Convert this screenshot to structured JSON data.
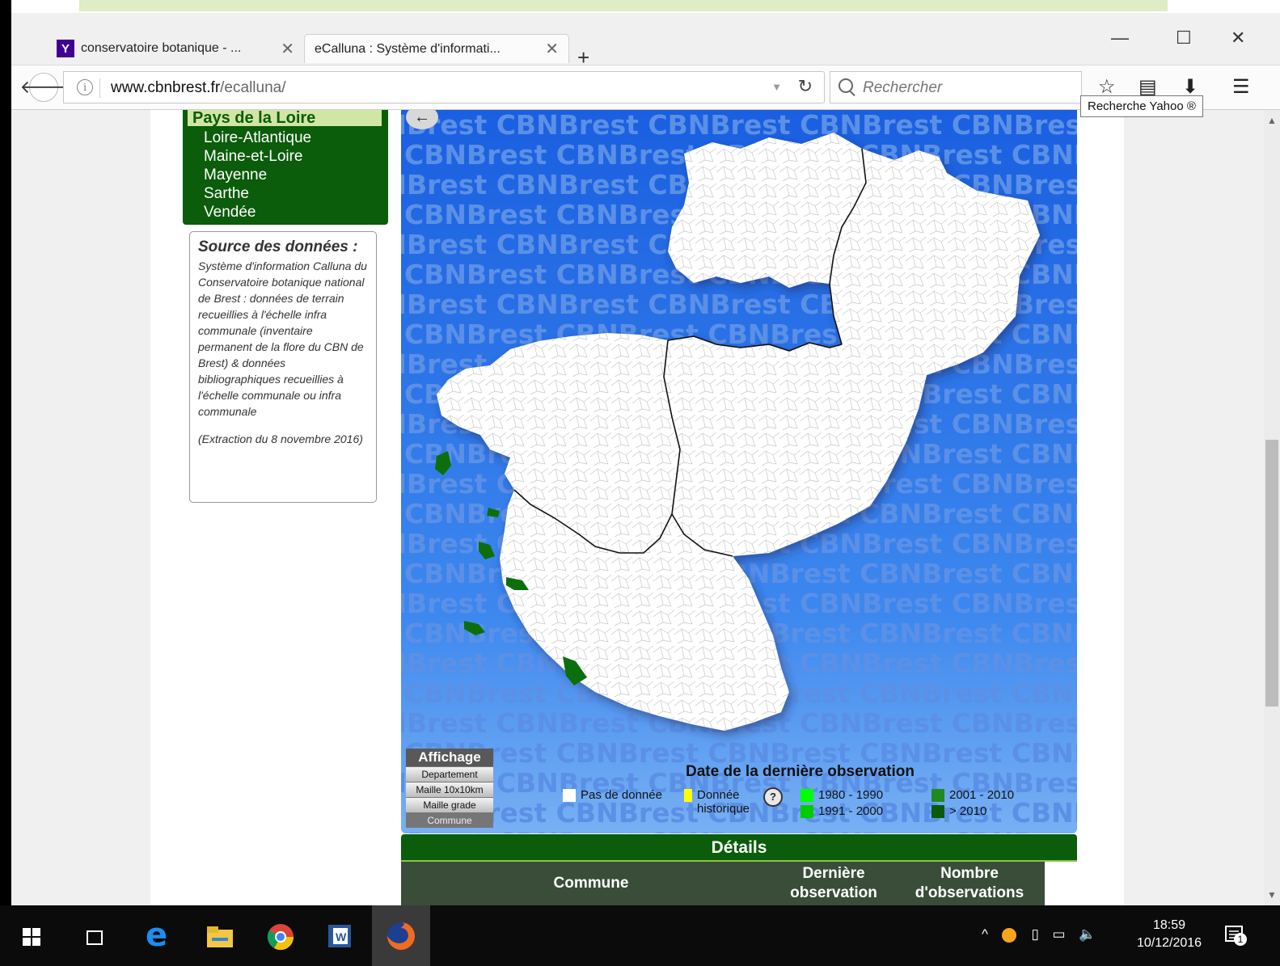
{
  "browser": {
    "tabs": [
      {
        "title": "conservatoire botanique - ...",
        "favicon": "Y",
        "active": false
      },
      {
        "title": "eCalluna : Système d'informati...",
        "active": true
      }
    ],
    "new_tab": "+",
    "window_controls": {
      "minimize": "—",
      "maximize": "☐",
      "close": "✕"
    },
    "url_host": "www.cbnbrest.fr",
    "url_path": "/ecalluna/",
    "search_placeholder": "Rechercher",
    "tooltip": "Recherche Yahoo ®",
    "toolbar_icons": [
      "star-icon",
      "reading-list-icon",
      "download-icon",
      "menu-icon"
    ]
  },
  "sidebar": {
    "region": "Pays de la Loire",
    "departments": [
      "Loire-Atlantique",
      "Maine-et-Loire",
      "Mayenne",
      "Sarthe",
      "Vendée"
    ],
    "source_title": "Source des données :",
    "source_body": "Système d'information Calluna du Conservatoire botanique national de Brest : données de terrain recueillies à l'échelle infra communale (inventaire permanent de la flore du CBN de Brest) & données bibliographiques recueillies à l'échelle communale ou infra communale",
    "extraction": "(Extraction du 8 novembre 2016)"
  },
  "map": {
    "back": "←",
    "watermark": "CBNBrest",
    "affichage": {
      "title": "Affichage",
      "options": [
        "Departement",
        "Maille 10x10km",
        "Maille grade",
        "Commune"
      ],
      "selected": "Commune"
    },
    "legend": {
      "title": "Date de la dernière observation",
      "items": [
        {
          "label": "Pas de donnée",
          "color": "#ffffff"
        },
        {
          "label": "Donnée historique",
          "color": "#ffff00"
        },
        {
          "label": "1980 - 1990",
          "color": "#00ff00"
        },
        {
          "label": "1991 - 2000",
          "color": "#00cc00"
        },
        {
          "label": "2001 - 2010",
          "color": "#1f8b1f"
        },
        {
          "label": "> 2010",
          "color": "#0a5a0a"
        }
      ],
      "help": "?"
    }
  },
  "details": {
    "title": "Détails",
    "columns": [
      "Commune",
      "Dernière observation",
      "Nombre d'observations"
    ]
  },
  "taskbar": {
    "time": "18:59",
    "date": "10/12/2016",
    "notification_count": "1"
  },
  "colors": {
    "dark_green": "#0b5c0b",
    "light_green": "#cfe6a4",
    "map_blue": "#3d88ef",
    "table_header": "#394d39"
  }
}
